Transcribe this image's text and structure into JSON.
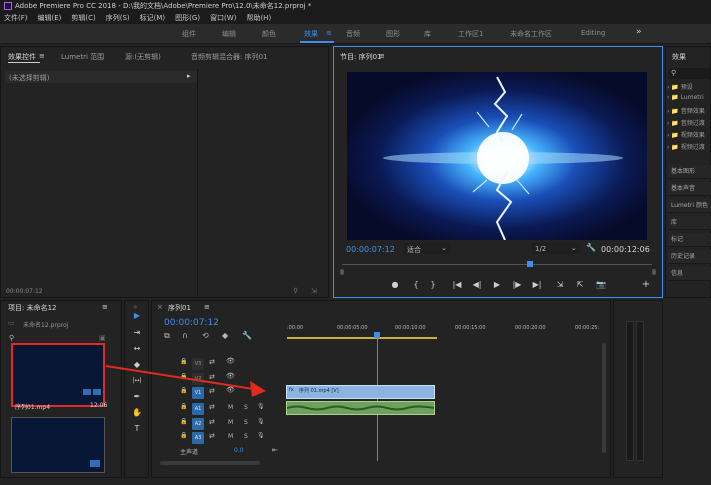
{
  "window": {
    "title": "Adobe Premiere Pro CC 2018 - D:\\我的文档\\Adobe\\Premiere Pro\\12.0\\未命名12.prproj *"
  },
  "menu": [
    "文件(F)",
    "编辑(E)",
    "剪辑(C)",
    "序列(S)",
    "标记(M)",
    "图形(G)",
    "窗口(W)",
    "帮助(H)"
  ],
  "workspaces": [
    "组件",
    "编辑",
    "颜色",
    "效果",
    "音频",
    "图形",
    "库",
    "工作区1",
    "未命名工作区",
    "Editing"
  ],
  "workspace_active": "效果",
  "workspace_more": "»",
  "effect_controls": {
    "tabs": [
      "效果控件",
      "Lumetri 范围",
      "源:(无剪辑)",
      "音频剪辑混合器: 序列01"
    ],
    "clip_select": "(未选择剪辑)",
    "play_arrow": "▸",
    "timecode": "00:00:07:12"
  },
  "program_monitor": {
    "tab": "节目: 序列01",
    "current_time": "00:00:07:12",
    "fit": "适合",
    "resolution": "1/2",
    "duration": "00:00:12:06",
    "wrench": "🔧",
    "transport": [
      "●",
      "{",
      "}",
      "|◀",
      "◀|",
      "▶",
      "|▶",
      "▶|",
      "⇲",
      "⇱",
      "📷"
    ],
    "add": "+"
  },
  "project": {
    "tab": "项目: 未命名12",
    "file": "未命名12.prproj",
    "clip_name": "序列01.mp4",
    "clip_duration": "12:06",
    "menu_icon": "≡"
  },
  "timeline": {
    "tab": "序列01",
    "timecode": "00:00:07:12",
    "ruler": [
      ":00:00",
      "00:00:05:00",
      "00:00:10:00",
      "00:00:15:00",
      "00:00:20:00",
      "00:00:25:"
    ],
    "video_tracks": [
      "V3",
      "V2",
      "V1"
    ],
    "audio_tracks": [
      "A1",
      "A2",
      "A3"
    ],
    "master": "主声道",
    "master_value": "0.0",
    "clip_label": "序列 01.mp4 [V]",
    "clip_fx": "fx",
    "track_letters": [
      "M",
      "S"
    ],
    "lock": "🔒",
    "eye": "👁",
    "mic": "🎙"
  },
  "effects_panel": {
    "tab": "效果",
    "search": "",
    "tree": [
      "预设",
      "Lumetri",
      "音频效果",
      "音频过渡",
      "视频效果",
      "视频过渡"
    ],
    "sections": [
      "基本图形",
      "基本声音",
      "Lumetri 颜色",
      "库",
      "标记",
      "历史记录",
      "信息"
    ]
  },
  "tools": [
    "▶",
    "⇥",
    "↔",
    "◆",
    "|↔|",
    "✒",
    "✋",
    "T"
  ],
  "colors": {
    "accent": "#3e8ef0",
    "annotation": "#e22a1e",
    "clip_video": "#8bb5e0",
    "clip_audio": "#6fa060"
  }
}
